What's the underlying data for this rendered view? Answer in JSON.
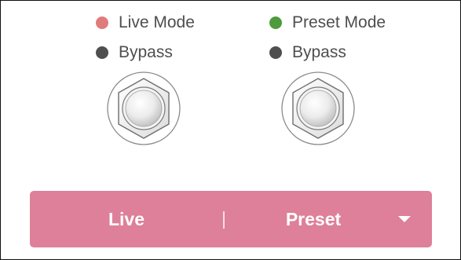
{
  "left_channel": {
    "mode_indicator": {
      "label": "Live Mode",
      "color": "#e07b7b"
    },
    "bypass_indicator": {
      "label": "Bypass",
      "color": "#4f4f4f"
    }
  },
  "right_channel": {
    "mode_indicator": {
      "label": "Preset Mode",
      "color": "#4f9a3c"
    },
    "bypass_indicator": {
      "label": "Bypass",
      "color": "#4f4f4f"
    }
  },
  "mode_bar": {
    "color": "#de8099",
    "live_label": "Live",
    "preset_label": "Preset",
    "dropdown_icon": "caret-down-icon"
  }
}
